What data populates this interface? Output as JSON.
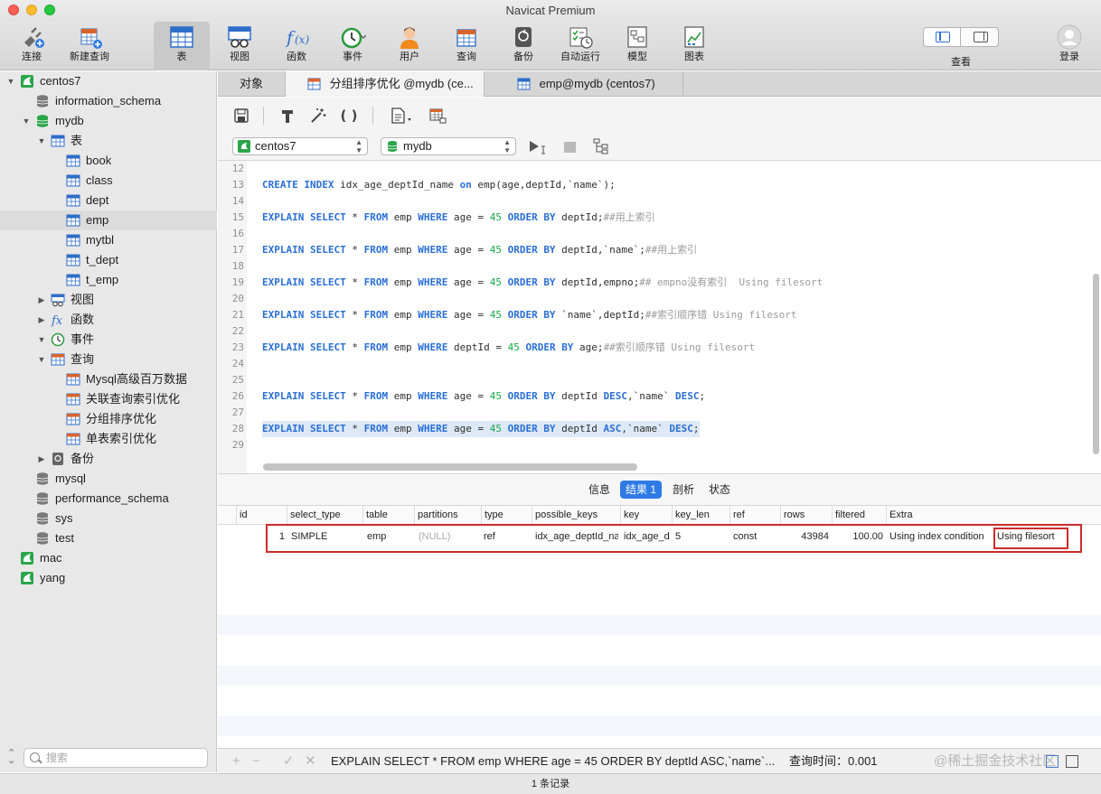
{
  "app": {
    "title": "Navicat Premium"
  },
  "toolbar": {
    "items": [
      {
        "label": "连接",
        "icon": "plug-icon"
      },
      {
        "label": "新建查询",
        "icon": "new-query-icon"
      },
      {
        "label": "表",
        "icon": "table-icon",
        "active": true
      },
      {
        "label": "视图",
        "icon": "view-icon"
      },
      {
        "label": "函数",
        "icon": "function-icon"
      },
      {
        "label": "事件",
        "icon": "event-clock-icon"
      },
      {
        "label": "用户",
        "icon": "user-icon"
      },
      {
        "label": "查询",
        "icon": "query-icon"
      },
      {
        "label": "备份",
        "icon": "backup-icon"
      },
      {
        "label": "自动运行",
        "icon": "auto-run-icon"
      },
      {
        "label": "模型",
        "icon": "model-icon"
      },
      {
        "label": "图表",
        "icon": "chart-icon"
      }
    ],
    "view_label": "查看",
    "login_label": "登录"
  },
  "sidebar": {
    "tree": [
      {
        "label": "centos7",
        "icon": "connection-icon",
        "disclosure": "▼"
      },
      {
        "label": "information_schema",
        "icon": "database-icon",
        "disclosure": ""
      },
      {
        "label": "mydb",
        "icon": "database-open-icon",
        "disclosure": "▼"
      },
      {
        "label": "表",
        "icon": "table-group-icon",
        "disclosure": "▼"
      },
      {
        "label": "book",
        "icon": "table-icon",
        "disclosure": ""
      },
      {
        "label": "class",
        "icon": "table-icon",
        "disclosure": ""
      },
      {
        "label": "dept",
        "icon": "table-icon",
        "disclosure": ""
      },
      {
        "label": "emp",
        "icon": "table-icon",
        "disclosure": "",
        "selected": true
      },
      {
        "label": "mytbl",
        "icon": "table-icon",
        "disclosure": ""
      },
      {
        "label": "t_dept",
        "icon": "table-icon",
        "disclosure": ""
      },
      {
        "label": "t_emp",
        "icon": "table-icon",
        "disclosure": ""
      },
      {
        "label": "视图",
        "icon": "view-group-icon",
        "disclosure": "▶"
      },
      {
        "label": "函数",
        "icon": "function-group-icon",
        "disclosure": "▶"
      },
      {
        "label": "事件",
        "icon": "event-group-icon",
        "disclosure": "▼"
      },
      {
        "label": "查询",
        "icon": "query-group-icon",
        "disclosure": "▼"
      },
      {
        "label": "Mysql高级百万数据",
        "icon": "query-icon",
        "disclosure": ""
      },
      {
        "label": "关联查询索引优化",
        "icon": "query-icon",
        "disclosure": ""
      },
      {
        "label": "分组排序优化",
        "icon": "query-icon",
        "disclosure": ""
      },
      {
        "label": "单表索引优化",
        "icon": "query-icon",
        "disclosure": ""
      },
      {
        "label": "备份",
        "icon": "backup-group-icon",
        "disclosure": "▶"
      },
      {
        "label": "mysql",
        "icon": "database-icon",
        "disclosure": ""
      },
      {
        "label": "performance_schema",
        "icon": "database-icon",
        "disclosure": ""
      },
      {
        "label": "sys",
        "icon": "database-icon",
        "disclosure": ""
      },
      {
        "label": "test",
        "icon": "database-icon",
        "disclosure": ""
      },
      {
        "label": "mac",
        "icon": "connection-icon",
        "disclosure": ""
      },
      {
        "label": "yang",
        "icon": "connection-icon",
        "disclosure": ""
      }
    ],
    "search_placeholder": "搜索"
  },
  "tabs": [
    {
      "label": "对象",
      "active": false
    },
    {
      "label": "分组排序优化 @mydb (ce...",
      "active": true,
      "icon": "query-icon"
    },
    {
      "label": "emp@mydb (centos7)",
      "active": false,
      "icon": "table-icon"
    }
  ],
  "connection": {
    "server": "centos7",
    "database": "mydb"
  },
  "editor": {
    "lines": [
      {
        "n": "12",
        "t": []
      },
      {
        "n": "13",
        "t": [
          [
            "kw",
            "CREATE INDEX"
          ],
          [
            "p",
            " idx_age_deptId_name "
          ],
          [
            "kw",
            "on"
          ],
          [
            "p",
            " emp(age,deptId,`name`);"
          ]
        ]
      },
      {
        "n": "14",
        "t": []
      },
      {
        "n": "15",
        "t": [
          [
            "kw",
            "EXPLAIN SELECT"
          ],
          [
            "p",
            " * "
          ],
          [
            "kw",
            "FROM"
          ],
          [
            "p",
            " emp "
          ],
          [
            "kw",
            "WHERE"
          ],
          [
            "p",
            " age = "
          ],
          [
            "num",
            "45"
          ],
          [
            "p",
            " "
          ],
          [
            "kw",
            "ORDER BY"
          ],
          [
            "p",
            " deptId;"
          ],
          [
            "cm",
            "##用上索引"
          ]
        ]
      },
      {
        "n": "16",
        "t": []
      },
      {
        "n": "17",
        "t": [
          [
            "kw",
            "EXPLAIN SELECT"
          ],
          [
            "p",
            " * "
          ],
          [
            "kw",
            "FROM"
          ],
          [
            "p",
            " emp "
          ],
          [
            "kw",
            "WHERE"
          ],
          [
            "p",
            " age = "
          ],
          [
            "num",
            "45"
          ],
          [
            "p",
            " "
          ],
          [
            "kw",
            "ORDER BY"
          ],
          [
            "p",
            " deptId,`name`;"
          ],
          [
            "cm",
            "##用上索引"
          ]
        ]
      },
      {
        "n": "18",
        "t": []
      },
      {
        "n": "19",
        "t": [
          [
            "kw",
            "EXPLAIN SELECT"
          ],
          [
            "p",
            " * "
          ],
          [
            "kw",
            "FROM"
          ],
          [
            "p",
            " emp "
          ],
          [
            "kw",
            "WHERE"
          ],
          [
            "p",
            " age = "
          ],
          [
            "num",
            "45"
          ],
          [
            "p",
            " "
          ],
          [
            "kw",
            "ORDER BY"
          ],
          [
            "p",
            " deptId,empno;"
          ],
          [
            "cm",
            "## empno没有索引  Using filesort"
          ]
        ]
      },
      {
        "n": "20",
        "t": []
      },
      {
        "n": "21",
        "t": [
          [
            "kw",
            "EXPLAIN SELECT"
          ],
          [
            "p",
            " * "
          ],
          [
            "kw",
            "FROM"
          ],
          [
            "p",
            " emp "
          ],
          [
            "kw",
            "WHERE"
          ],
          [
            "p",
            " age = "
          ],
          [
            "num",
            "45"
          ],
          [
            "p",
            " "
          ],
          [
            "kw",
            "ORDER BY"
          ],
          [
            "p",
            " `name`,deptId;"
          ],
          [
            "cm",
            "##索引顺序错 Using filesort"
          ]
        ]
      },
      {
        "n": "22",
        "t": []
      },
      {
        "n": "23",
        "t": [
          [
            "kw",
            "EXPLAIN SELECT"
          ],
          [
            "p",
            " * "
          ],
          [
            "kw",
            "FROM"
          ],
          [
            "p",
            " emp "
          ],
          [
            "kw",
            "WHERE"
          ],
          [
            "p",
            " deptId = "
          ],
          [
            "num",
            "45"
          ],
          [
            "p",
            " "
          ],
          [
            "kw",
            "ORDER BY"
          ],
          [
            "p",
            " age;"
          ],
          [
            "cm",
            "##索引顺序错 Using filesort"
          ]
        ]
      },
      {
        "n": "24",
        "t": []
      },
      {
        "n": "25",
        "t": []
      },
      {
        "n": "26",
        "t": [
          [
            "kw",
            "EXPLAIN SELECT"
          ],
          [
            "p",
            " * "
          ],
          [
            "kw",
            "FROM"
          ],
          [
            "p",
            " emp "
          ],
          [
            "kw",
            "WHERE"
          ],
          [
            "p",
            " age = "
          ],
          [
            "num",
            "45"
          ],
          [
            "p",
            " "
          ],
          [
            "kw",
            "ORDER BY"
          ],
          [
            "p",
            " deptId "
          ],
          [
            "kw",
            "DESC"
          ],
          [
            "p",
            ",`name` "
          ],
          [
            "kw",
            "DESC"
          ],
          [
            "p",
            ";"
          ]
        ]
      },
      {
        "n": "27",
        "t": []
      },
      {
        "n": "28",
        "hl": true,
        "t": [
          [
            "kw",
            "EXPLAIN SELECT"
          ],
          [
            "p",
            " * "
          ],
          [
            "kw",
            "FROM"
          ],
          [
            "p",
            " emp "
          ],
          [
            "kw",
            "WHERE"
          ],
          [
            "p",
            " age = "
          ],
          [
            "num",
            "45"
          ],
          [
            "p",
            " "
          ],
          [
            "kw",
            "ORDER BY"
          ],
          [
            "p",
            " deptId "
          ],
          [
            "kw",
            "ASC"
          ],
          [
            "p",
            ",`name` "
          ],
          [
            "kw",
            "DESC"
          ],
          [
            "p",
            ";"
          ]
        ]
      },
      {
        "n": "29",
        "t": []
      }
    ]
  },
  "results": {
    "tabs": [
      "信息",
      "结果 1",
      "剖析",
      "状态"
    ],
    "active_tab": "结果 1",
    "columns": [
      "id",
      "select_type",
      "table",
      "partitions",
      "type",
      "possible_keys",
      "key",
      "key_len",
      "ref",
      "rows",
      "filtered",
      "Extra"
    ],
    "rows": [
      {
        "id": "1",
        "select_type": "SIMPLE",
        "table": "emp",
        "partitions": "(NULL)",
        "type": "ref",
        "possible_keys": "idx_age_deptId_name",
        "key": "idx_age_deptId_name",
        "key_len": "5",
        "ref": "const",
        "rows": "43984",
        "filtered": "100.00",
        "extra_main": "Using index condition",
        "extra_highlight": "Using filesort"
      }
    ]
  },
  "bottom": {
    "sql": "EXPLAIN SELECT * FROM emp WHERE age = 45 ORDER BY deptId ASC,`name`...",
    "query_time": "查询时间：0.001",
    "watermark": "@稀土掘金技术社区"
  },
  "status": {
    "records": "1 条记录"
  },
  "colors": {
    "accent": "#2f7ae5",
    "keyword": "#2a6fd6",
    "number": "#1aa64a",
    "comment": "#9b9b9b",
    "highlight_box": "#cc2b2b"
  }
}
